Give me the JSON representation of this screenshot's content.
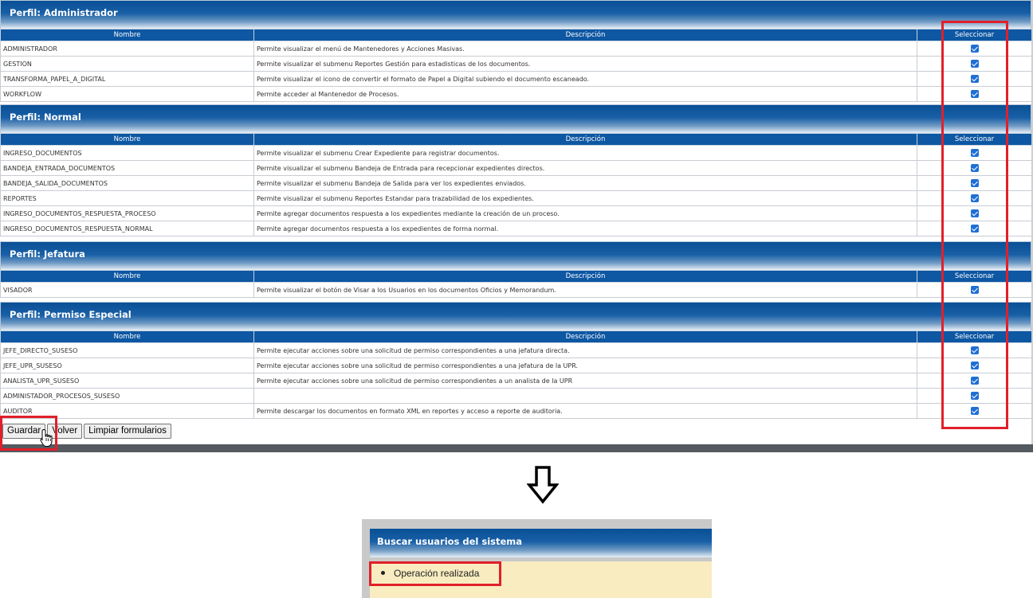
{
  "columns": {
    "nombre": "Nombre",
    "descripcion": "Descripción",
    "seleccionar": "Seleccionar"
  },
  "sections": [
    {
      "title": "Perfil: Administrador",
      "rows": [
        {
          "nombre": "ADMINISTRADOR",
          "descripcion": "Permite visualizar el menú de Mantenedores y Acciones Masivas.",
          "checked": true
        },
        {
          "nombre": "GESTION",
          "descripcion": "Permite visualizar el submenu Reportes Gestión para estadisticas de los documentos.",
          "checked": true
        },
        {
          "nombre": "TRANSFORMA_PAPEL_A_DIGITAL",
          "descripcion": "Permite visualizar el icono de convertir el formato de Papel a Digital subiendo el documento escaneado.",
          "checked": true
        },
        {
          "nombre": "WORKFLOW",
          "descripcion": "Permite acceder al Mantenedor de Procesos.",
          "checked": true
        }
      ]
    },
    {
      "title": "Perfil: Normal",
      "rows": [
        {
          "nombre": "INGRESO_DOCUMENTOS",
          "descripcion": "Permite visualizar el submenu Crear Expediente para registrar documentos.",
          "checked": true
        },
        {
          "nombre": "BANDEJA_ENTRADA_DOCUMENTOS",
          "descripcion": "Permite visualizar el submenu Bandeja de Entrada para recepcionar expedientes directos.",
          "checked": true
        },
        {
          "nombre": "BANDEJA_SALIDA_DOCUMENTOS",
          "descripcion": "Permite visualizar el submenu Bandeja de Salida para ver los expedientes enviados.",
          "checked": true
        },
        {
          "nombre": "REPORTES",
          "descripcion": "Permite visualizar el submenu Reportes Estandar para trazabilidad de los expedientes.",
          "checked": true
        },
        {
          "nombre": "INGRESO_DOCUMENTOS_RESPUESTA_PROCESO",
          "descripcion": "Permite agregar documentos respuesta a los expedientes mediante la creación de un proceso.",
          "checked": true
        },
        {
          "nombre": "INGRESO_DOCUMENTOS_RESPUESTA_NORMAL",
          "descripcion": "Permite agregar documentos respuesta a los expedientes de forma normal.",
          "checked": true
        }
      ]
    },
    {
      "title": "Perfil: Jefatura",
      "rows": [
        {
          "nombre": "VISADOR",
          "descripcion": "Permite visualizar el botón de Visar a los Usuarios en los documentos Oficios y Memorandum.",
          "checked": true
        }
      ]
    },
    {
      "title": "Perfil: Permiso Especial",
      "rows": [
        {
          "nombre": "JEFE_DIRECTO_SUSESO",
          "descripcion": "Permite ejecutar acciones sobre una solicitud de permiso correspondientes a una jefatura directa.",
          "checked": true
        },
        {
          "nombre": "JEFE_UPR_SUSESO",
          "descripcion": "Permite ejecutar acciones sobre una solicitud de permiso correspondientes a una jefatura de la UPR.",
          "checked": true
        },
        {
          "nombre": "ANALISTA_UPR_SUSESO",
          "descripcion": "Permite ejecutar acciones sobre una solicitud de permiso correspondientes a un analista de la UPR",
          "checked": true
        },
        {
          "nombre": "ADMINISTADOR_PROCESOS_SUSESO",
          "descripcion": "",
          "checked": true
        },
        {
          "nombre": "AUDITOR",
          "descripcion": "Permite descargar los documentos en formato XML en reportes y acceso a reporte de auditoria.",
          "checked": true
        }
      ]
    }
  ],
  "buttons": {
    "guardar": "Guardar",
    "volver": "Volver",
    "limpiar": "Limpiar formularios"
  },
  "result": {
    "header": "Buscar usuarios del sistema",
    "message": "Operación realizada"
  },
  "colors": {
    "header_blue": "#0d57a3",
    "highlight_red": "#e0202a",
    "message_bg": "#f8ecc0",
    "checkbox_blue": "#1f6fd4"
  },
  "icons": {
    "cursor": "hand-pointer-icon",
    "arrow": "arrow-down-icon"
  }
}
